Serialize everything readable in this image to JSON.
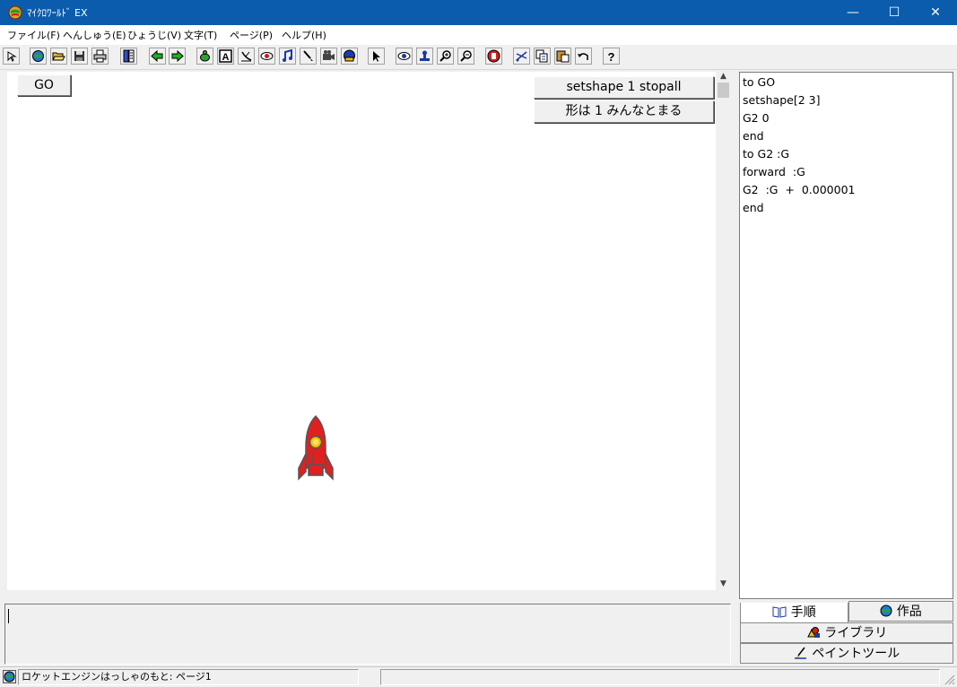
{
  "window": {
    "title": "ﾏｲｸﾛﾜｰﾙﾄﾞ EX",
    "minimize_glyph": "—",
    "maximize_glyph": "☐",
    "close_glyph": "✕"
  },
  "menu": [
    {
      "label": "ファイル(F)"
    },
    {
      "label": "へんしゅう(E)"
    },
    {
      "label": "ひょうじ(V)"
    },
    {
      "label": "文字(T)"
    },
    {
      "label": "ページ(P)"
    },
    {
      "label": "ヘルプ(H)"
    }
  ],
  "toolbar": {
    "icons": [
      "pointer-arrow-icon",
      "globe-icon",
      "open-folder-icon",
      "save-icon",
      "print-icon",
      "layout-icon",
      "back-arrow-icon",
      "forward-arrow-icon",
      "turtle-icon",
      "text-box-icon",
      "satellite-icon",
      "eye-shape-icon",
      "music-note-icon",
      "brush-icon",
      "camera-icon",
      "robot-icon",
      "select-cursor-icon",
      "view-eye-icon",
      "stamp-icon",
      "zoom-in-icon",
      "zoom-out-icon",
      "stop-hand-icon",
      "scissors-icon",
      "copy-icon",
      "paste-icon",
      "undo-icon",
      "help-icon"
    ],
    "help_glyph": "?"
  },
  "canvas": {
    "go_button": "GO",
    "stopall_button": "setshape 1 stopall",
    "reset_button": "形は 1 みんなとまる",
    "turtle_shape": "rocket-icon"
  },
  "procedures": {
    "lines": [
      "to GO",
      "setshape[2 3]",
      "G2 0",
      "end",
      "to G2 :G",
      "forward  :G",
      "G2  :G  +  0.000001",
      "end"
    ]
  },
  "tabs": {
    "procedures": "手順",
    "work": "作品",
    "library": "ライブラリ",
    "paint_tool": "ペイントツール"
  },
  "command_center": {
    "value": ""
  },
  "status": {
    "project_text": "ロケットエンジンはっしゃのもと:  ページ1"
  },
  "colors": {
    "titlebar": "#0b5cac",
    "rocket": "#e02020",
    "rocket_window": "#f5c000"
  }
}
